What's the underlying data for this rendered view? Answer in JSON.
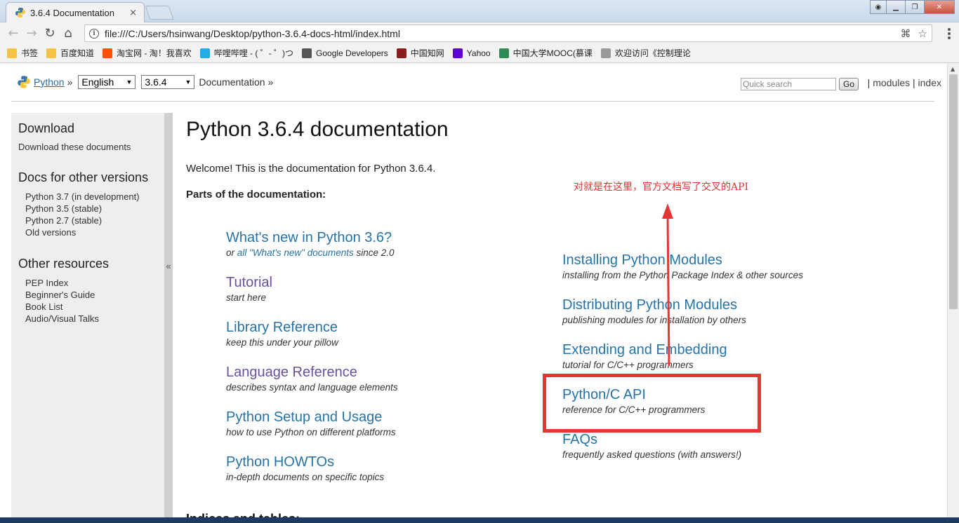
{
  "browser": {
    "tab_title": "3.6.4 Documentation",
    "tab_close": "×",
    "url": "file:///C:/Users/hsinwang/Desktop/python-3.6.4-docs-html/index.html",
    "bookmarks": [
      {
        "label": "书签",
        "icon": "folder-icon",
        "color": "#f5c242"
      },
      {
        "label": "百度知道",
        "icon": "folder-icon",
        "color": "#f5c242"
      },
      {
        "label": "淘宝网 - 淘！我喜欢",
        "icon": "taobao-icon",
        "color": "#ff5000"
      },
      {
        "label": "哔哩哔哩 - ( ゜- ゜)つ",
        "icon": "bilibili-icon",
        "color": "#23ade5"
      },
      {
        "label": "Google Developers",
        "icon": "google-developers-icon",
        "color": "#555555"
      },
      {
        "label": "中国知网",
        "icon": "cnki-icon",
        "color": "#8a1c1c"
      },
      {
        "label": "Yahoo",
        "icon": "yahoo-icon",
        "color": "#5f01d1"
      },
      {
        "label": "中国大学MOOC(慕课",
        "icon": "mooc-icon",
        "color": "#2e8b57"
      },
      {
        "label": "欢迎访问《控制理论",
        "icon": "page-icon",
        "color": "#999999"
      }
    ]
  },
  "related": {
    "python_link": "Python",
    "sep": "»",
    "language": "English",
    "version": "3.6.4",
    "documentation": "Documentation »",
    "search_placeholder": "Quick search",
    "go": "Go",
    "modules": "modules",
    "bar": "|",
    "index": "index"
  },
  "sidebar": {
    "download_title": "Download",
    "download_link": "Download these documents",
    "versions_title": "Docs for other versions",
    "versions": [
      "Python 3.7 (in development)",
      "Python 3.5 (stable)",
      "Python 2.7 (stable)",
      "Old versions"
    ],
    "resources_title": "Other resources",
    "resources": [
      "PEP Index",
      "Beginner's Guide",
      "Book List",
      "Audio/Visual Talks"
    ],
    "collapse": "«"
  },
  "main": {
    "title": "Python 3.6.4 documentation",
    "welcome": "Welcome! This is the documentation for Python 3.6.4.",
    "parts": "Parts of the documentation:",
    "left": [
      {
        "title": "What's new in Python 3.6?",
        "desc_pre": "or ",
        "desc_link": "all \"What's new\" documents",
        "desc_post": " since 2.0"
      },
      {
        "title": "Tutorial",
        "desc": "start here"
      },
      {
        "title": "Library Reference",
        "desc": "keep this under your pillow"
      },
      {
        "title": "Language Reference",
        "desc": "describes syntax and language elements"
      },
      {
        "title": "Python Setup and Usage",
        "desc": "how to use Python on different platforms"
      },
      {
        "title": "Python HOWTOs",
        "desc": "in-depth documents on specific topics"
      }
    ],
    "right": [
      {
        "title": "Installing Python Modules",
        "desc": "installing from the Python Package Index & other sources"
      },
      {
        "title": "Distributing Python Modules",
        "desc": "publishing modules for installation by others"
      },
      {
        "title": "Extending and Embedding",
        "desc": "tutorial for C/C++ programmers"
      },
      {
        "title": "Python/C API",
        "desc": "reference for C/C++ programmers"
      },
      {
        "title": "FAQs",
        "desc": "frequently asked questions (with answers!)"
      }
    ],
    "indices": "Indices and tables:"
  },
  "annotation": {
    "text": "对就是在这里，官方文档写了交叉的API",
    "color": "#e03030"
  },
  "colors": {
    "link": "#2573a8",
    "visited": "#6a4fa1",
    "sidebar_bg": "#eeeeee"
  }
}
